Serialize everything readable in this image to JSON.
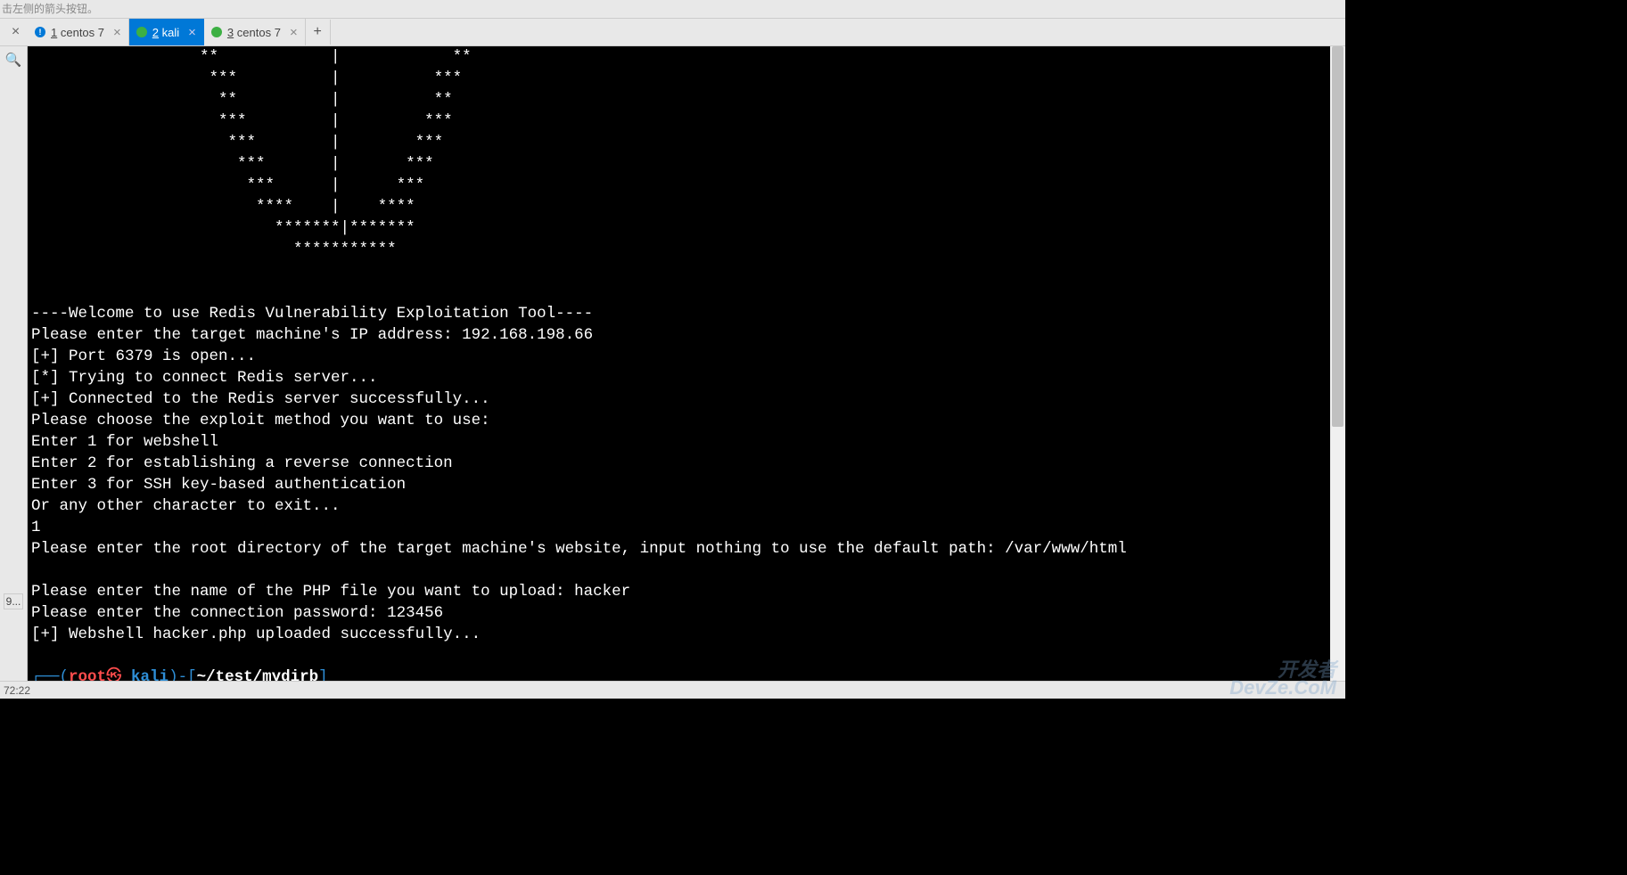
{
  "titlebar": {
    "hint": "击左侧的箭头按钮。"
  },
  "tabs": {
    "left_close": "×",
    "items": [
      {
        "number": "1",
        "label": "centos 7",
        "icon": "info-blue",
        "active": false
      },
      {
        "number": "2",
        "label": "kali",
        "icon": "green-dot",
        "active": true
      },
      {
        "number": "3",
        "label": "centos 7",
        "icon": "green-dot",
        "active": false
      }
    ],
    "close_char": "×",
    "new_tab_char": "+"
  },
  "sidebar": {
    "search_glyph": "🔍",
    "bottom_label": "9..."
  },
  "terminal": {
    "banner_lines": [
      "                  **            |            **",
      "                   ***          |          ***",
      "                    **          |          **",
      "                    ***         |         ***",
      "                     ***        |        ***",
      "                      ***       |       ***",
      "                       ***      |      ***",
      "                        ****    |    ****",
      "                          *******|*******",
      "                            ***********"
    ],
    "output_lines": [
      "",
      "----Welcome to use Redis Vulnerability Exploitation Tool----",
      "Please enter the target machine's IP address: 192.168.198.66",
      "[+] Port 6379 is open...",
      "[*] Trying to connect Redis server...",
      "[+] Connected to the Redis server successfully...",
      "Please choose the exploit method you want to use:",
      "Enter 1 for webshell",
      "Enter 2 for establishing a reverse connection",
      "Enter 3 for SSH key-based authentication",
      "Or any other character to exit...",
      "1",
      "Please enter the root directory of the target machine's website, input nothing to use the default path: /var/www/html",
      "",
      "Please enter the name of the PHP file you want to upload: hacker",
      "Please enter the connection password: 123456",
      "[+] Webshell hacker.php uploaded successfully..."
    ],
    "prompt": {
      "box_top": "┌──",
      "paren_open": "(",
      "user": "root",
      "at": "㉿",
      "host": " kali",
      "paren_close": ")",
      "dash": "-",
      "bracket_open": "[",
      "path": "~/test/mydirb",
      "bracket_close": "]",
      "box_bottom": "└─",
      "hash": "#"
    }
  },
  "statusbar": {
    "position": "72:22"
  },
  "watermark": {
    "line1": "开发者",
    "line2": "DevZe.CoM"
  }
}
